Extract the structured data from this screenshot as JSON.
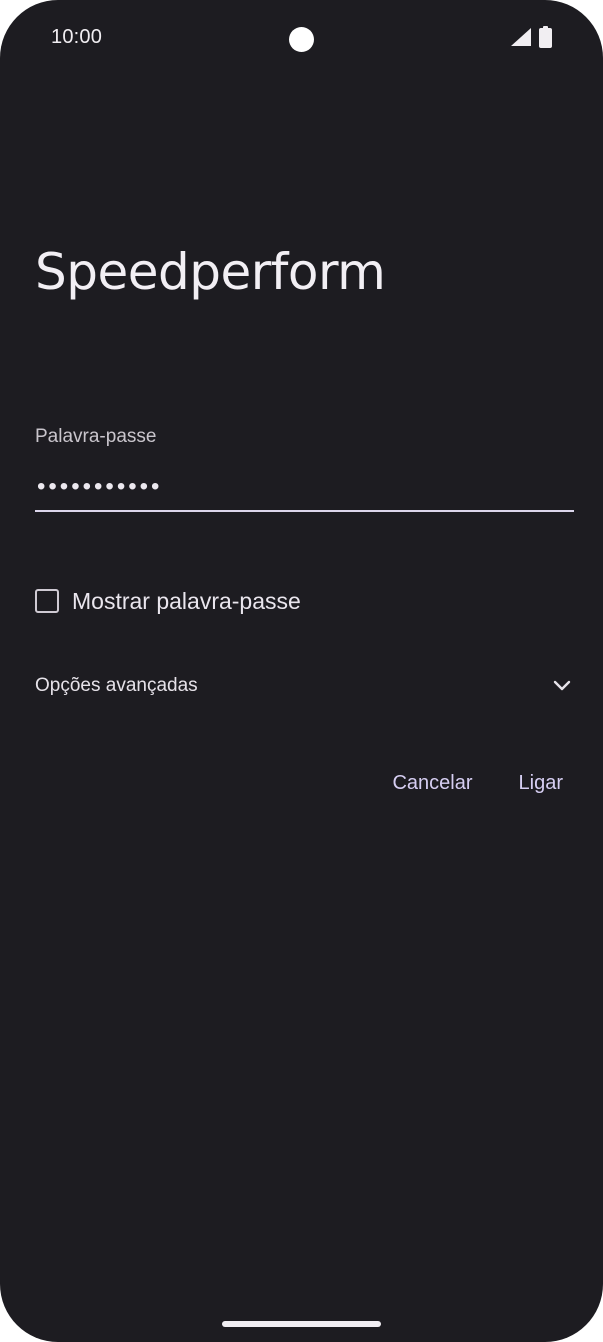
{
  "status_bar": {
    "time": "10:00",
    "icons": [
      "camera-cutout",
      "signal-icon",
      "battery-icon"
    ]
  },
  "dialog": {
    "title": "Speedperform",
    "password": {
      "label": "Palavra-passe",
      "value": "•••••••••••"
    },
    "show_password": {
      "label": "Mostrar palavra-passe",
      "checked": false
    },
    "advanced_options": {
      "label": "Opções avançadas",
      "expanded": false
    },
    "buttons": {
      "cancel": "Cancelar",
      "connect": "Ligar"
    }
  },
  "colors": {
    "background": "#1d1c21",
    "text_primary": "#e6e1e6",
    "accent": "#d6cef2",
    "underline": "#dcd6ec"
  }
}
